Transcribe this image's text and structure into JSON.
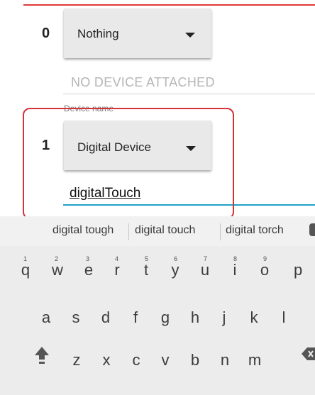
{
  "rows": [
    {
      "index": "0",
      "device_type": "Nothing",
      "name_value": "NO DEVICE ATTACHED"
    },
    {
      "index": "1",
      "device_type": "Digital Device",
      "name_label": "Device name",
      "name_value": "digitalTouch"
    }
  ],
  "keyboard": {
    "suggestions": [
      "digital tough",
      "digital touch",
      "digital torch"
    ],
    "row1": [
      "q",
      "w",
      "e",
      "r",
      "t",
      "y",
      "u",
      "i",
      "o",
      "p"
    ],
    "row1_hints": [
      "1",
      "2",
      "3",
      "4",
      "5",
      "6",
      "7",
      "8",
      "9"
    ],
    "row2": [
      "a",
      "s",
      "d",
      "f",
      "g",
      "h",
      "j",
      "k",
      "l"
    ],
    "row3": [
      "z",
      "x",
      "c",
      "v",
      "b",
      "n",
      "m"
    ],
    "icons": [
      "shift-icon",
      "backspace-icon",
      "microphone-icon"
    ]
  },
  "colors": {
    "highlight": "#d6323a",
    "focus_underline": "#1ea1c9",
    "top_line": "#e03a3a"
  }
}
